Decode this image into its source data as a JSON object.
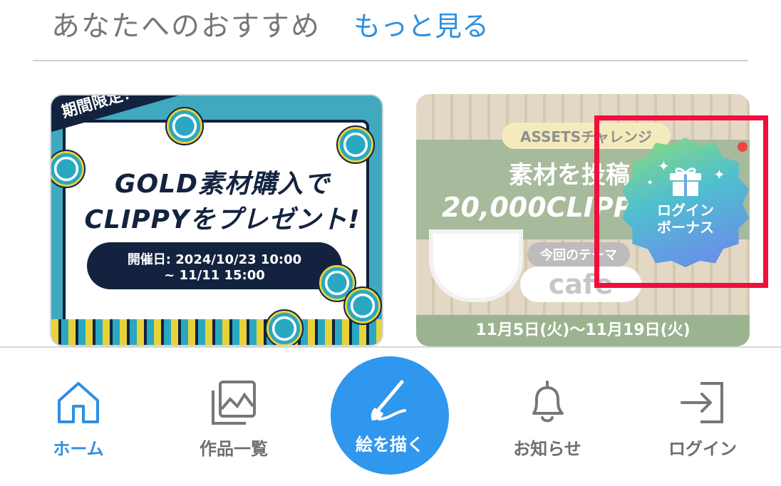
{
  "section": {
    "title": "あなたへのおすすめ",
    "more_link": "もっと見る"
  },
  "banners": [
    {
      "ribbon": "期間限定！",
      "headline_1": "GOLD素材購入で",
      "headline_2": "CLIPPYをプレゼント!",
      "date_line_1": "開催日: 2024/10/23 10:00",
      "date_line_2": "~ 11/11 15:00"
    },
    {
      "tag": "ASSETSチャレンジ",
      "line_1": "素材を投稿し",
      "line_2": "20,000CLIPPYをゲ",
      "theme_label": "今回のテーマ",
      "theme": "cafe",
      "dates": "11月5日(火)～11月19日(火)"
    }
  ],
  "login_bonus": {
    "line_1": "ログイン",
    "line_2": "ボーナス"
  },
  "bottom_nav": {
    "home": "ホーム",
    "works": "作品一覧",
    "draw": "絵を描く",
    "notifications": "お知らせ",
    "login": "ログイン"
  },
  "colors": {
    "accent": "#2f8fe0",
    "draw_button": "#2f97ee",
    "highlight_frame": "#f00f3c",
    "notification_dot": "#f04545"
  }
}
